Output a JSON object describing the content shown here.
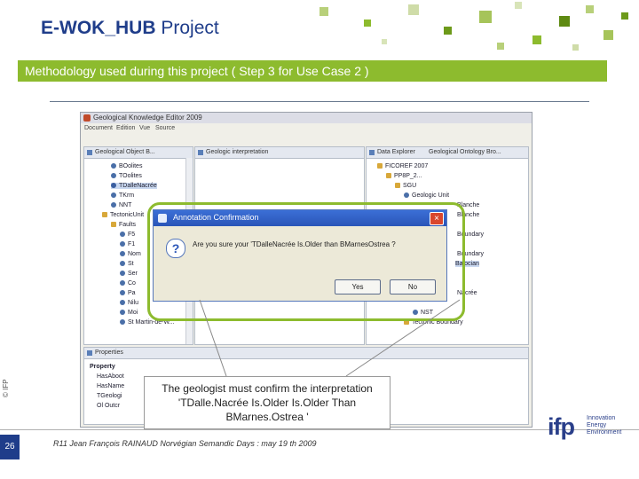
{
  "slide": {
    "title_strong": "E-WOK_HUB",
    "title_rest": "Project",
    "subtitle": "Methodology used during this project ( Step 3 for Use Case 2 )"
  },
  "window": {
    "title": "Geological Knowledge Editor 2009",
    "menu": [
      "Document",
      "Edition",
      "Vue",
      "Source"
    ],
    "left_pane_tab": "Geological Object B...",
    "left_tree": [
      "BOolites",
      "TOolites",
      "TDalleNacrée",
      "TKrm",
      "NNT",
      "TectonicUnit",
      "Faults",
      "F5",
      "F1",
      "Nom",
      "St",
      "Ser",
      "Co",
      "Pa",
      "Nilu",
      "Moi",
      "St Martin-de-W..."
    ],
    "center_pane_tab": "Geologic interpretation",
    "right_pane_tab_1": "Data Explorer",
    "right_pane_tab_2": "Geological Ontology Bro...",
    "right_tree": [
      "FICOREF 2007",
      "PP8P_2...",
      "SGU",
      "Geologic Unit",
      "Blanche",
      "Blanche",
      "Boundary",
      "Boundary",
      "Bajocian",
      "Nacrée",
      "NST",
      "Tectonic Boundary"
    ],
    "bottom_pane_tab": "Properties",
    "properties": [
      {
        "key": "Property",
        "value": ""
      },
      {
        "key": "HasAboot",
        "value": ""
      },
      {
        "key": "HasName",
        "value": ""
      },
      {
        "key": "TGeologi",
        "value": ""
      },
      {
        "key": "Ol Outcr",
        "value": ""
      }
    ]
  },
  "dialog": {
    "title": "Annotation Confirmation",
    "message": "Are you sure your 'TDalleNacrée Is.Older than BMarnesOstrea ?",
    "yes_label": "Yes",
    "no_label": "No",
    "close_glyph": "×",
    "question_glyph": "?"
  },
  "callout": {
    "text": "The geologist must confirm the interpretation 'TDalle.Nacrée Is.Older Is.Older Than BMarnes.Ostrea '"
  },
  "footer": {
    "slide_number": "26",
    "text": "R11 Jean François RAINAUD Norvégian Semandic Days : may 19 th 2009",
    "copyright": "© IFP",
    "logo": "ifp",
    "logo_sub": "Innovation\nEnergy\nEnvironment"
  },
  "colors": {
    "brand_blue": "#1f3d8a",
    "brand_green": "#8dbb2e"
  }
}
